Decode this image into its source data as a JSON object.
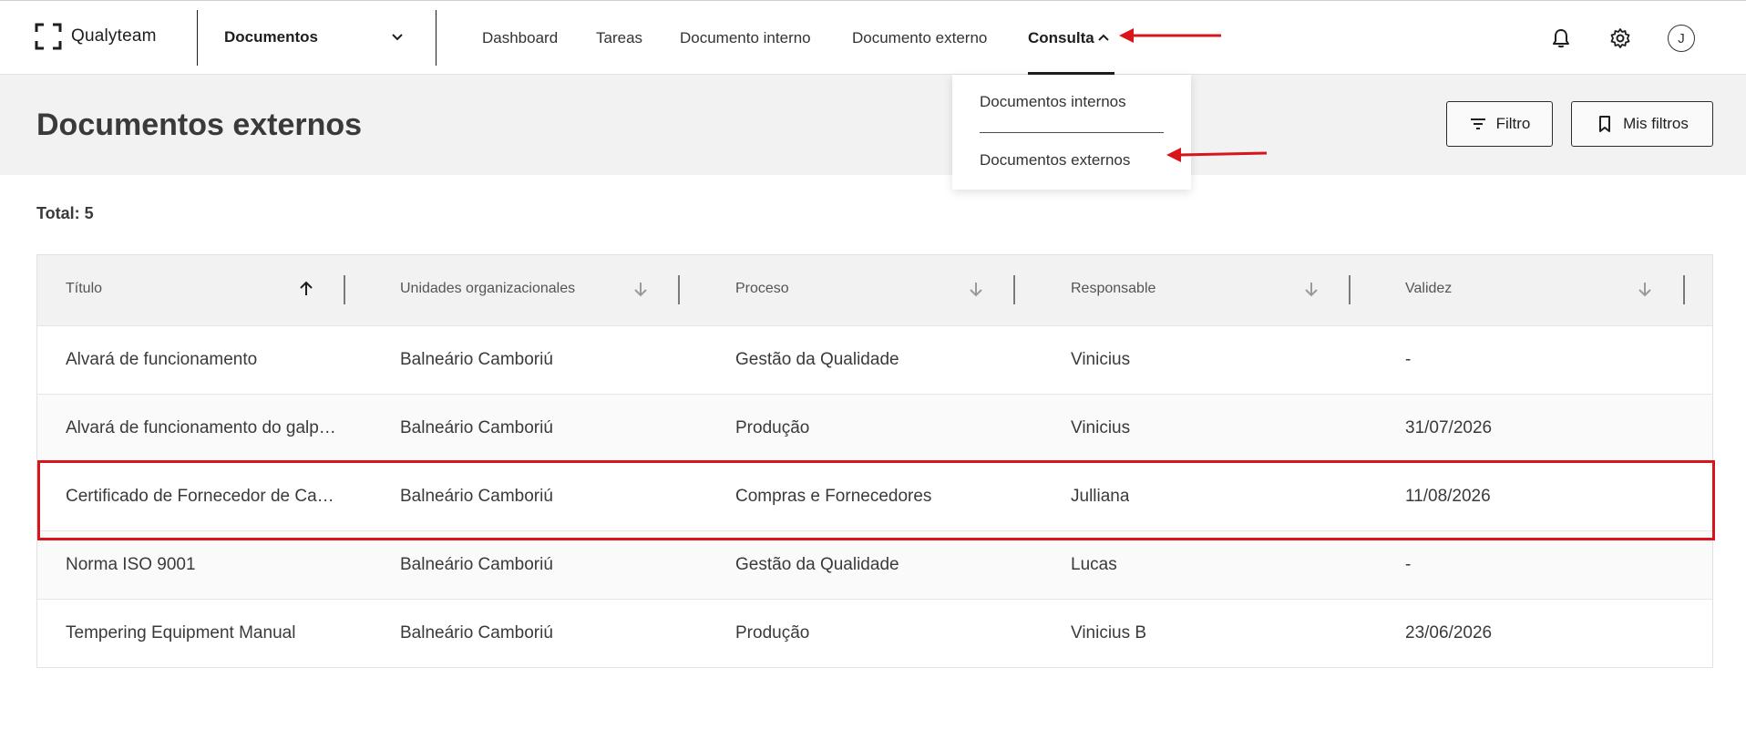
{
  "app": {
    "name": "Qualyteam",
    "module": "Documentos"
  },
  "nav": [
    {
      "label": "Dashboard"
    },
    {
      "label": "Tareas"
    },
    {
      "label": "Documento interno"
    },
    {
      "label": "Documento externo"
    },
    {
      "label": "Consulta"
    }
  ],
  "user": {
    "initial": "J"
  },
  "dropdown": {
    "items": [
      "Documentos internos",
      "Documentos externos"
    ]
  },
  "page": {
    "title": "Documentos externos",
    "total_label": "Total: 5"
  },
  "buttons": {
    "filter": "Filtro",
    "my_filters": "Mis filtros"
  },
  "table": {
    "headers": [
      "Título",
      "Unidades organizacionales",
      "Proceso",
      "Responsable",
      "Validez"
    ],
    "rows": [
      [
        "Alvará de funcionamento",
        "Balneário Camboriú",
        "Gestão da Qualidade",
        "Vinicius",
        "-"
      ],
      [
        "Alvará de funcionamento do galp…",
        "Balneário Camboriú",
        "Produção",
        "Vinicius",
        "31/07/2026"
      ],
      [
        "Certificado de Fornecedor de Ca…",
        "Balneário Camboriú",
        "Compras e Fornecedores",
        "Julliana",
        "11/08/2026"
      ],
      [
        "Norma ISO 9001",
        "Balneário Camboriú",
        "Gestão da Qualidade",
        "Lucas",
        "-"
      ],
      [
        "Tempering Equipment Manual",
        "Balneário Camboriú",
        "Produção",
        "Vinicius B",
        "23/06/2026"
      ]
    ]
  },
  "icons": {
    "logo": "qualyteam-logo-icon",
    "notifications": "bell-icon",
    "settings": "gear-icon",
    "filter": "filter-icon",
    "bookmark": "bookmark-icon"
  },
  "colors": {
    "annotation": "#d9151b",
    "header_band": "#f2f2f2",
    "text": "#2b2b2b"
  }
}
